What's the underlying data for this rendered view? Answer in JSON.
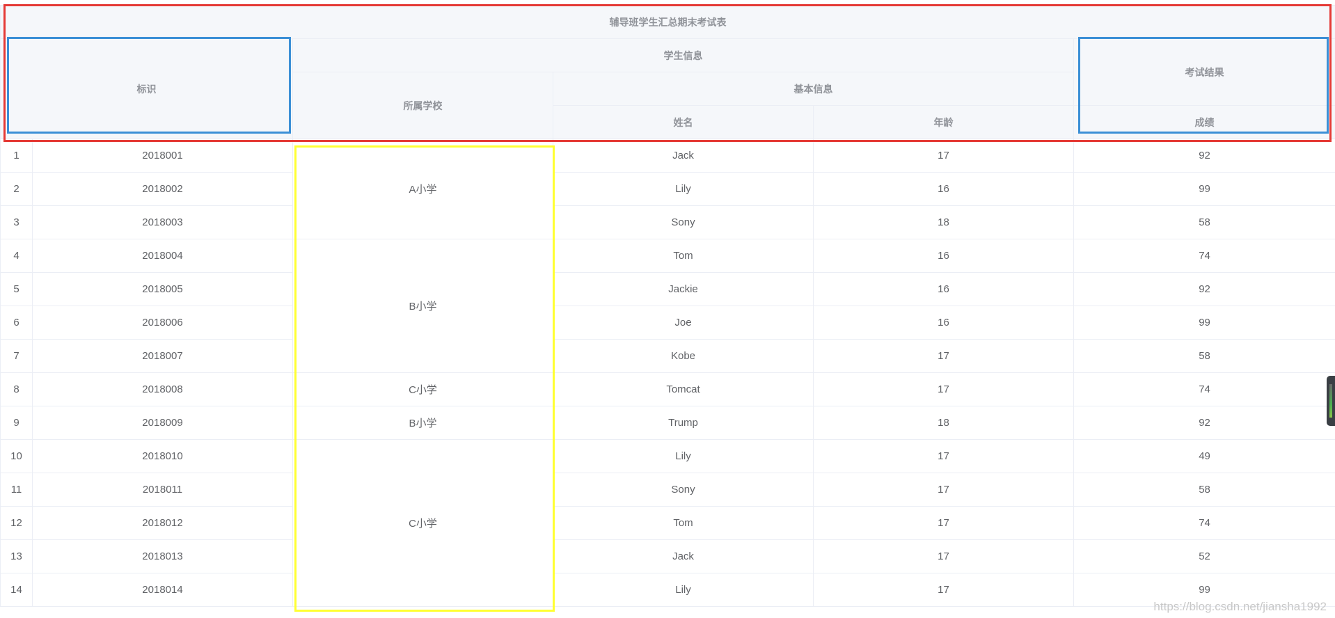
{
  "table": {
    "title": "辅导班学生汇总期末考试表",
    "headers": {
      "id": "标识",
      "student_info": "学生信息",
      "school": "所属学校",
      "basic_info": "基本信息",
      "name": "姓名",
      "age": "年龄",
      "exam_result": "考试结果",
      "score": "成绩"
    },
    "rows": [
      {
        "index": "1",
        "id": "2018001",
        "name": "Jack",
        "age": "17",
        "score": "92"
      },
      {
        "index": "2",
        "id": "2018002",
        "name": "Lily",
        "age": "16",
        "score": "99"
      },
      {
        "index": "3",
        "id": "2018003",
        "name": "Sony",
        "age": "18",
        "score": "58"
      },
      {
        "index": "4",
        "id": "2018004",
        "name": "Tom",
        "age": "16",
        "score": "74"
      },
      {
        "index": "5",
        "id": "2018005",
        "name": "Jackie",
        "age": "16",
        "score": "92"
      },
      {
        "index": "6",
        "id": "2018006",
        "name": "Joe",
        "age": "16",
        "score": "99"
      },
      {
        "index": "7",
        "id": "2018007",
        "name": "Kobe",
        "age": "17",
        "score": "58"
      },
      {
        "index": "8",
        "id": "2018008",
        "name": "Tomcat",
        "age": "17",
        "score": "74"
      },
      {
        "index": "9",
        "id": "2018009",
        "name": "Trump",
        "age": "18",
        "score": "92"
      },
      {
        "index": "10",
        "id": "2018010",
        "name": "Lily",
        "age": "17",
        "score": "49"
      },
      {
        "index": "11",
        "id": "2018011",
        "name": "Sony",
        "age": "17",
        "score": "58"
      },
      {
        "index": "12",
        "id": "2018012",
        "name": "Tom",
        "age": "17",
        "score": "74"
      },
      {
        "index": "13",
        "id": "2018013",
        "name": "Jack",
        "age": "17",
        "score": "52"
      },
      {
        "index": "14",
        "id": "2018014",
        "name": "Lily",
        "age": "17",
        "score": "99"
      }
    ],
    "school_groups": [
      {
        "label": "A小学",
        "rowspan": 3
      },
      {
        "label": "B小学",
        "rowspan": 4
      },
      {
        "label": "C小学",
        "rowspan": 1
      },
      {
        "label": "B小学",
        "rowspan": 1
      },
      {
        "label": "C小学",
        "rowspan": 5
      }
    ]
  },
  "annotation_colors": {
    "header_box": "#e53935",
    "fixed_columns": "#3b8fd6",
    "merged_school_column": "#ffff33"
  },
  "watermark": "https://blog.csdn.net/jiansha1992"
}
